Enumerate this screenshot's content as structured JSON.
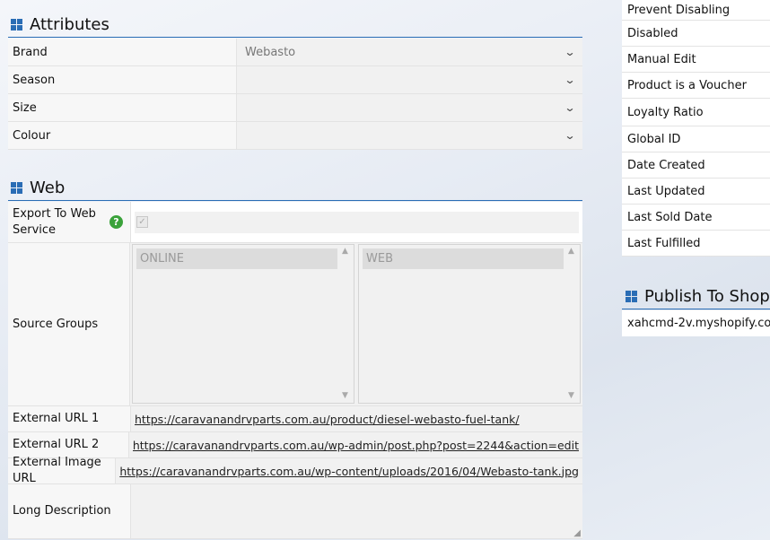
{
  "attributes": {
    "title": "Attributes",
    "rows": [
      {
        "label": "Brand",
        "value": "Webasto"
      },
      {
        "label": "Season",
        "value": ""
      },
      {
        "label": "Size",
        "value": ""
      },
      {
        "label": "Colour",
        "value": ""
      }
    ]
  },
  "web": {
    "title": "Web",
    "export_label": "Export To Web Service",
    "export_checked": true,
    "source_groups_label": "Source Groups",
    "source_groups_left": [
      "ONLINE"
    ],
    "source_groups_right": [
      "WEB"
    ],
    "external_url_1_label": "External URL 1",
    "external_url_1": "https://caravanandrvparts.com.au/product/diesel-webasto-fuel-tank/",
    "external_url_2_label": "External URL 2",
    "external_url_2": "https://caravanandrvparts.com.au/wp-admin/post.php?post=2244&action=edit",
    "external_image_url_label": "External Image URL",
    "external_image_url": "https://caravanandrvparts.com.au/wp-content/uploads/2016/04/Webasto-tank.jpg",
    "long_description_label": "Long Description"
  },
  "right_panel": {
    "items": [
      "Prevent Disabling",
      "Disabled",
      "Manual Edit",
      "Product is a Voucher",
      "Loyalty Ratio",
      "Global ID",
      "Date Created",
      "Last Updated",
      "Last Sold Date",
      "Last Fulfilled"
    ]
  },
  "shopify": {
    "title": "Publish To Shopify",
    "store": "xahcmd-2v.myshopify.com"
  },
  "colors": {
    "accent": "#2a6db5",
    "help": "#3aa23a"
  },
  "icons": {
    "section": "grid-icon",
    "help": "help-icon",
    "select": "chevron-down-icon"
  }
}
